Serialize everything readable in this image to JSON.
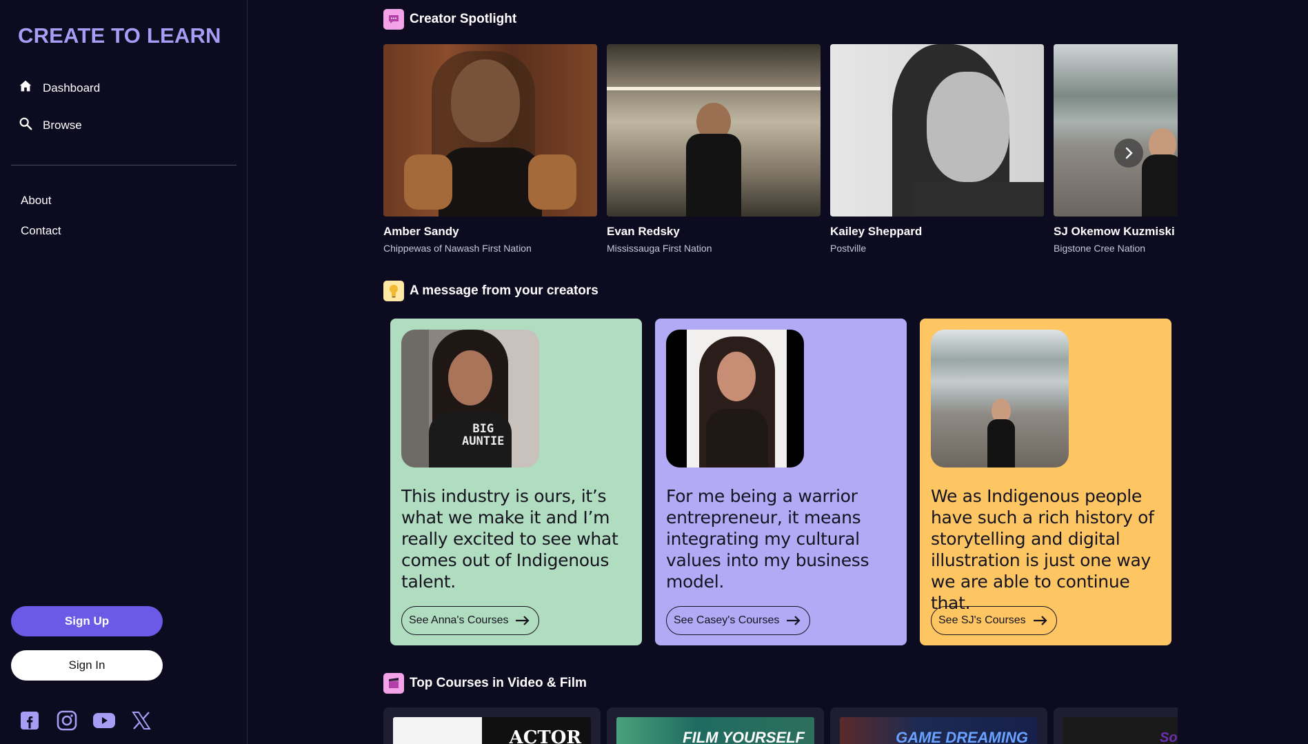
{
  "sidebar": {
    "brand": "CREATE TO LEARN",
    "nav": [
      {
        "label": "Dashboard",
        "icon": "home-icon"
      },
      {
        "label": "Browse",
        "icon": "search-icon"
      }
    ],
    "links": [
      {
        "label": "About"
      },
      {
        "label": "Contact"
      }
    ],
    "signup_label": "Sign Up",
    "signin_label": "Sign In",
    "social": [
      "facebook-icon",
      "instagram-icon",
      "youtube-icon",
      "x-icon"
    ]
  },
  "spotlight": {
    "title": "Creator Spotlight",
    "icon": "chat-icon",
    "creators": [
      {
        "name": "Amber Sandy",
        "nation": "Chippewas of Nawash First Nation"
      },
      {
        "name": "Evan Redsky",
        "nation": "Mississauga First Nation"
      },
      {
        "name": "Kailey Sheppard",
        "nation": "Postville"
      },
      {
        "name": "SJ Okemow Kuzmiski",
        "nation": "Bigstone Cree Nation"
      }
    ]
  },
  "messages": {
    "title": "A message from your creators",
    "icon": "lightbulb-icon",
    "cards": [
      {
        "quote": "This industry is ours, it’s what we make it and I’m really excited to see what comes out of Indigenous talent.",
        "button": "See Anna's Courses",
        "color": "#b0dcbf"
      },
      {
        "quote": "For me being a warrior entrepreneur, it means integrating my cultural values into my business model.",
        "button": "See Casey's Courses",
        "color": "#b3aaf6"
      },
      {
        "quote": "We as Indigenous people have such a rich history of storytelling and digital illustration is just one way we are able to continue that.",
        "button": "See SJ's Courses",
        "color": "#fdc663"
      }
    ]
  },
  "courses": {
    "title": "Top Courses in Video & Film",
    "icon": "clapperboard-icon",
    "thumbs": [
      "ACTOR",
      "FILM YOURSELF",
      "GAME DREAMING",
      "So Be"
    ]
  }
}
